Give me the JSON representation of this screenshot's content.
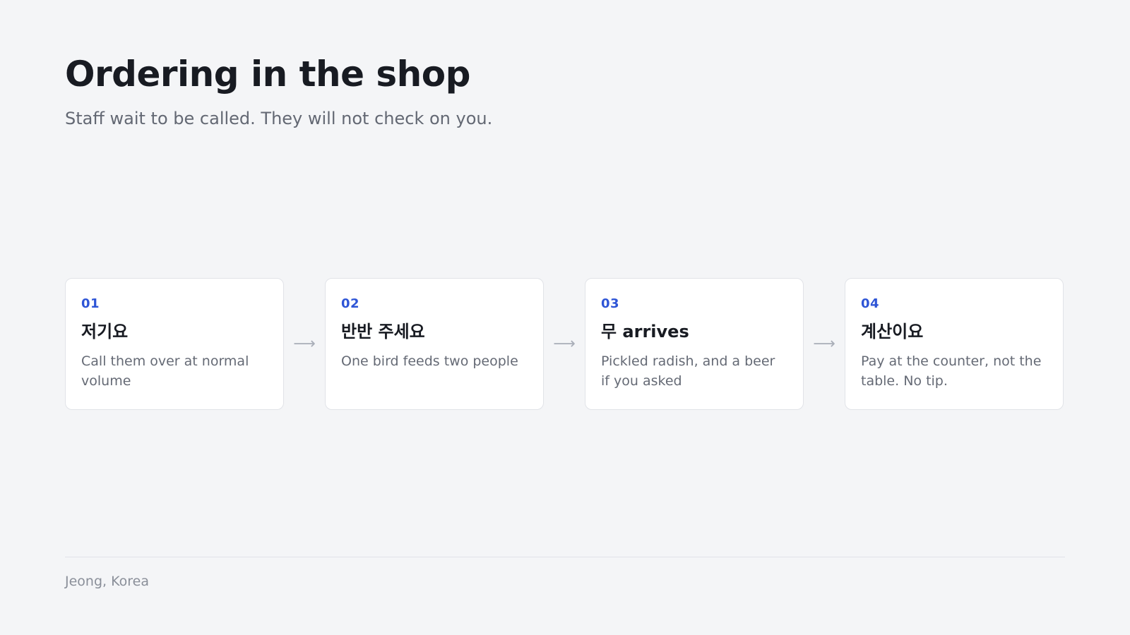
{
  "header": {
    "title": "Ordering in the shop",
    "subtitle": "Staff wait to be called. They will not check on you."
  },
  "steps": [
    {
      "number": "01",
      "title": "저기요",
      "description": "Call them over at normal volume"
    },
    {
      "number": "02",
      "title": "반반 주세요",
      "description": "One bird feeds two people"
    },
    {
      "number": "03",
      "title": "무 arrives",
      "description": "Pickled radish, and a beer if you asked"
    },
    {
      "number": "04",
      "title": "계산이요",
      "description": "Pay at the counter, not the table. No tip."
    }
  ],
  "arrow_glyph": "⟶",
  "footer": {
    "location": "Jeong, Korea"
  },
  "colors": {
    "background": "#f4f5f7",
    "accent": "#2e55d6",
    "card": "#ffffff"
  }
}
